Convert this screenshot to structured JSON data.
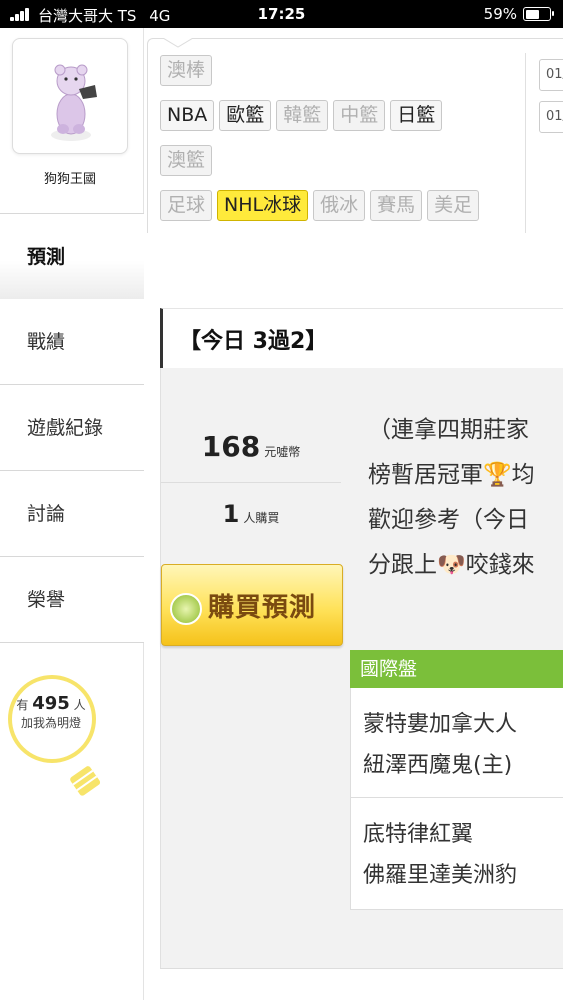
{
  "status_bar": {
    "carrier": "台灣大哥大 TS",
    "network": "4G",
    "time": "17:25",
    "battery_text": "59%",
    "battery_level": 0.59
  },
  "sidebar": {
    "username": "狗狗王國",
    "nav_items": [
      {
        "label": "預測",
        "active": true
      },
      {
        "label": "戰績",
        "active": false
      },
      {
        "label": "遊戲紀錄",
        "active": false
      },
      {
        "label": "討論",
        "active": false
      },
      {
        "label": "榮譽",
        "active": false
      }
    ],
    "light_prefix": "有",
    "light_count": "495",
    "light_suffix": "人",
    "light_caption": "加我為明燈"
  },
  "filters": {
    "row1": [
      {
        "label": "澳棒",
        "state": "disabled"
      }
    ],
    "row2": [
      {
        "label": "NBA",
        "state": "enabled"
      },
      {
        "label": "歐籃",
        "state": "enabled"
      },
      {
        "label": "韓籃",
        "state": "disabled"
      },
      {
        "label": "中籃",
        "state": "disabled"
      },
      {
        "label": "日籃",
        "state": "enabled"
      }
    ],
    "row3": [
      {
        "label": "澳籃",
        "state": "disabled"
      }
    ],
    "row4": [
      {
        "label": "足球",
        "state": "disabled"
      },
      {
        "label": "NHL冰球",
        "state": "selected"
      },
      {
        "label": "俄冰",
        "state": "disabled"
      },
      {
        "label": "賽馬",
        "state": "disabled"
      },
      {
        "label": "美足",
        "state": "disabled"
      }
    ],
    "dates": [
      "01/",
      "01/"
    ]
  },
  "main": {
    "title": "【今日 3過2】",
    "coins_value": "168",
    "coins_unit": "元噓幣",
    "buyers_value": "1",
    "buyers_unit": "人購買",
    "buy_button_label": "購買預測",
    "description_lines": [
      "（連拿四期莊家",
      "榜暫居冠軍🏆均",
      "歡迎參考（今日",
      "分跟上🐶咬錢來"
    ],
    "section_label": "國際盤",
    "games": [
      {
        "team1": "蒙特婁加拿大人",
        "team2": "紐澤西魔鬼(主)"
      },
      {
        "team1": "底特律紅翼",
        "team2": "佛羅里達美洲豹"
      }
    ]
  }
}
